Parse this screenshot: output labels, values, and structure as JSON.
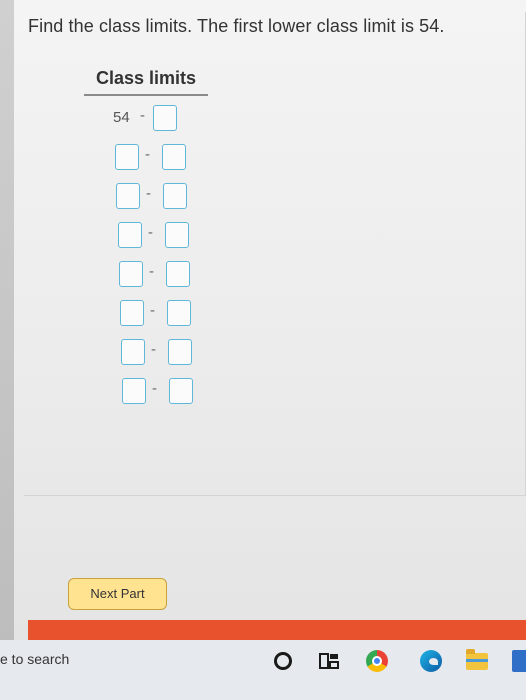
{
  "question": "Find the class limits. The first lower class limit is 54.",
  "table": {
    "header": "Class limits",
    "first_lower": "54",
    "separator": "-",
    "rows": 8
  },
  "next_button_label": "Next Part",
  "taskbar": {
    "search_text": "e to search",
    "icons": [
      "cortana-circle-icon",
      "task-view-icon",
      "chrome-icon",
      "edge-icon",
      "file-explorer-icon",
      "store-icon"
    ]
  },
  "colors": {
    "input_border": "#5fb7d9",
    "next_button_bg": "#ffe391",
    "red_band": "#e8532e"
  }
}
